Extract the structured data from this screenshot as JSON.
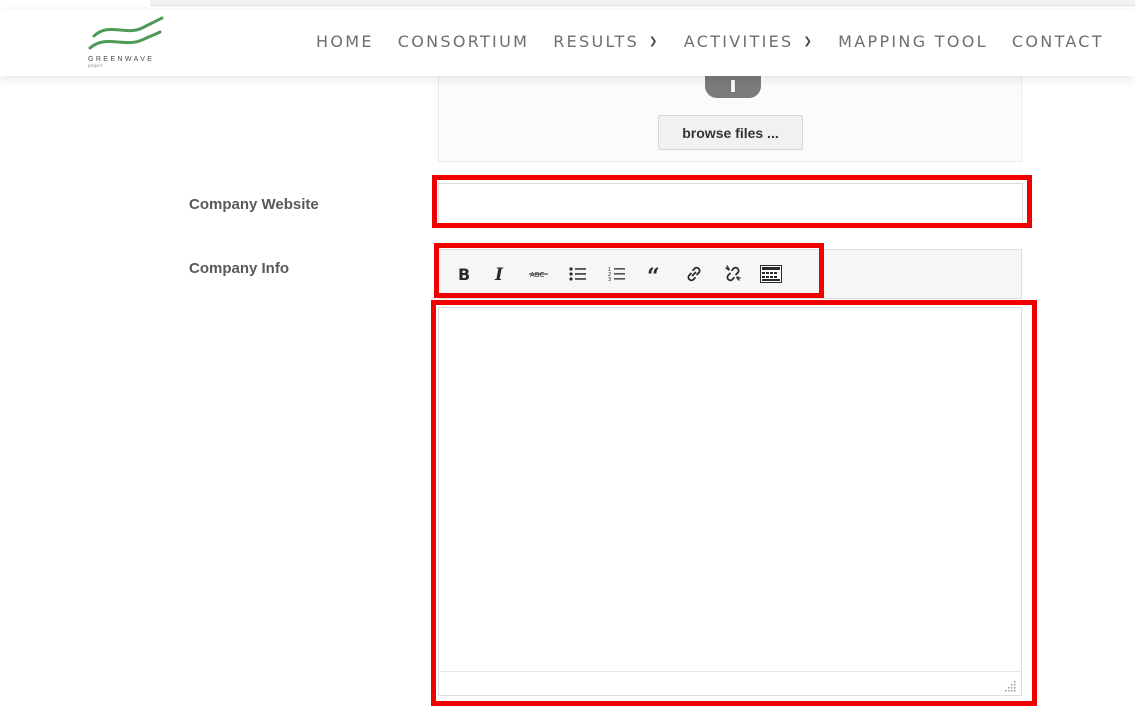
{
  "header": {
    "logo": {
      "brand": "GREENWAVE",
      "tagline": "project",
      "icon": "greenwave-logo"
    },
    "nav": [
      {
        "label": "HOME",
        "has_dropdown": false
      },
      {
        "label": "CONSORTIUM",
        "has_dropdown": false
      },
      {
        "label": "RESULTS",
        "has_dropdown": true
      },
      {
        "label": "ACTIVITIES",
        "has_dropdown": true
      },
      {
        "label": "MAPPING TOOL",
        "has_dropdown": false
      },
      {
        "label": "CONTACT",
        "has_dropdown": false
      }
    ],
    "chevron_icon": "chevron-down-icon"
  },
  "upload": {
    "icon": "upload-cloud-icon",
    "browse_label": "browse files ..."
  },
  "form": {
    "website_label": "Company Website",
    "website_value": "",
    "info_label": "Company Info",
    "info_value": ""
  },
  "toolbar": {
    "buttons": [
      {
        "icon": "bold-icon",
        "title": "Bold"
      },
      {
        "icon": "italic-icon",
        "title": "Italic"
      },
      {
        "icon": "strikethrough-icon",
        "title": "Strikethrough"
      },
      {
        "icon": "bulleted-list-icon",
        "title": "Bulleted list"
      },
      {
        "icon": "numbered-list-icon",
        "title": "Numbered list"
      },
      {
        "icon": "blockquote-icon",
        "title": "Blockquote"
      },
      {
        "icon": "link-icon",
        "title": "Insert link"
      },
      {
        "icon": "unlink-icon",
        "title": "Remove link"
      },
      {
        "icon": "toolbar-toggle-icon",
        "title": "Toolbar toggle"
      }
    ]
  },
  "colors": {
    "highlight": "#f00000",
    "logo_green": "#4f9a54",
    "nav_text": "#6e6e6e"
  }
}
